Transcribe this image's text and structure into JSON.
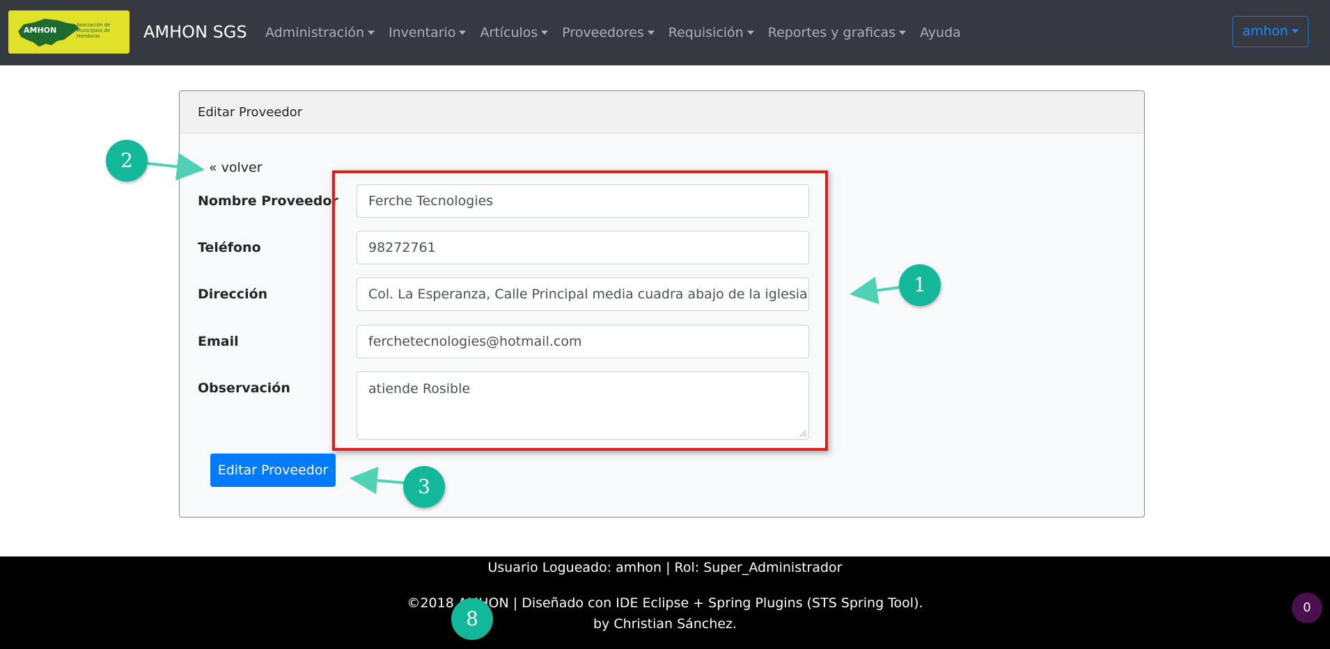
{
  "navbar": {
    "logo_text": "AMHON",
    "logo_subtext": "Asociación de Municipios de Honduras",
    "brand": "AMHON SGS",
    "items": [
      {
        "label": "Administración",
        "dropdown": true
      },
      {
        "label": "Inventario",
        "dropdown": true
      },
      {
        "label": "Artículos",
        "dropdown": true
      },
      {
        "label": "Proveedores",
        "dropdown": true
      },
      {
        "label": "Requisición",
        "dropdown": true
      },
      {
        "label": "Reportes y graficas",
        "dropdown": true
      },
      {
        "label": "Ayuda",
        "dropdown": false
      }
    ],
    "user_menu": "amhon"
  },
  "card": {
    "header": "Editar Proveedor",
    "back_link": "« volver",
    "fields": {
      "nombre": {
        "label": "Nombre Proveedor",
        "value": "Ferche Tecnologies"
      },
      "telefono": {
        "label": "Teléfono",
        "value": "98272761"
      },
      "direccion": {
        "label": "Dirección",
        "value": "Col. La Esperanza, Calle Principal media cuadra abajo de la iglesia cato"
      },
      "email": {
        "label": "Email",
        "value": "ferchetecnologies@hotmail.com"
      },
      "observacion": {
        "label": "Observación",
        "value": "atiende Rosible"
      }
    },
    "submit_label": "Editar Proveedor"
  },
  "annotations": {
    "marker_1": "1",
    "marker_2": "2",
    "marker_3": "3",
    "marker_8": "8",
    "colors": {
      "marker": "#13b89a",
      "highlight_box": "#e31b1b"
    }
  },
  "footer": {
    "line1": "Usuario Logueado: amhon | Rol: Super_Administrador",
    "line2": "©2018 AMHON | Diseñado con IDE Eclipse + Spring Plugins (STS Spring Tool).",
    "line3": "by Christian Sánchez."
  },
  "badge": "0",
  "colors": {
    "navbar": "#343a40",
    "primary": "#007bff",
    "footer": "#000000",
    "logo_bg": "#e2e12a"
  }
}
